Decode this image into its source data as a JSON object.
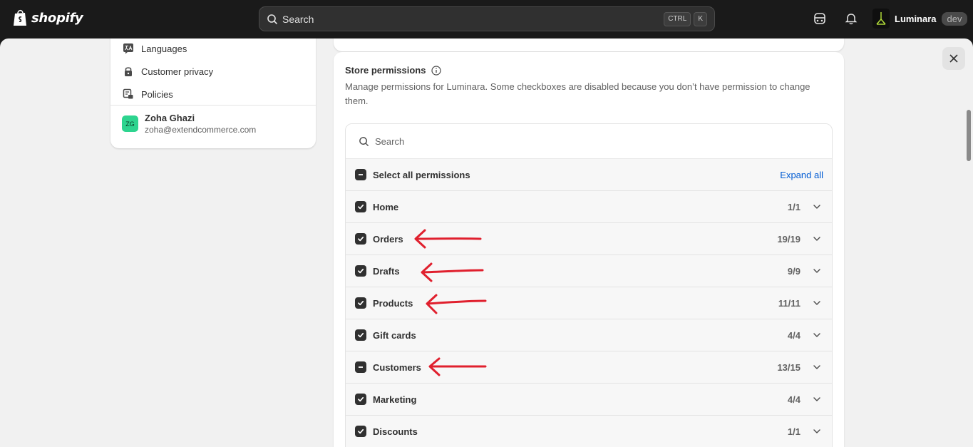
{
  "topbar": {
    "logo_text": "shopify",
    "search_placeholder": "Search",
    "shortcut_keys": [
      "CTRL",
      "K"
    ],
    "store_name": "Luminara",
    "store_badge": "dev",
    "icons": [
      "store-switcher-icon",
      "bell-icon"
    ]
  },
  "sidebar": {
    "items": [
      {
        "label": "Languages",
        "icon": "language-icon"
      },
      {
        "label": "Customer privacy",
        "icon": "lock-icon"
      },
      {
        "label": "Policies",
        "icon": "policy-icon"
      }
    ],
    "user": {
      "initials": "ZG",
      "name": "Zoha Ghazi",
      "email": "zoha@extendcommerce.com"
    }
  },
  "permissions": {
    "title": "Store permissions",
    "description": "Manage permissions for Luminara. Some checkboxes are disabled because you don’t have permission to change them.",
    "search_placeholder": "Search",
    "select_all_label": "Select all permissions",
    "expand_all_label": "Expand all",
    "rows": [
      {
        "label": "Home",
        "count": "1/1",
        "state": "checked",
        "arrow": false
      },
      {
        "label": "Orders",
        "count": "19/19",
        "state": "checked",
        "arrow": true
      },
      {
        "label": "Drafts",
        "count": "9/9",
        "state": "checked",
        "arrow": true
      },
      {
        "label": "Products",
        "count": "11/11",
        "state": "checked",
        "arrow": true
      },
      {
        "label": "Gift cards",
        "count": "4/4",
        "state": "checked",
        "arrow": false
      },
      {
        "label": "Customers",
        "count": "13/15",
        "state": "indeterminate",
        "arrow": true
      },
      {
        "label": "Marketing",
        "count": "4/4",
        "state": "checked",
        "arrow": false
      },
      {
        "label": "Discounts",
        "count": "1/1",
        "state": "checked",
        "arrow": false
      }
    ]
  },
  "colors": {
    "topbar_bg": "#1a1a1a",
    "page_bg": "#f1f1f1",
    "link": "#005bd3",
    "annotation_arrow": "#e0202e",
    "avatar_bg": "#2dd48f"
  }
}
